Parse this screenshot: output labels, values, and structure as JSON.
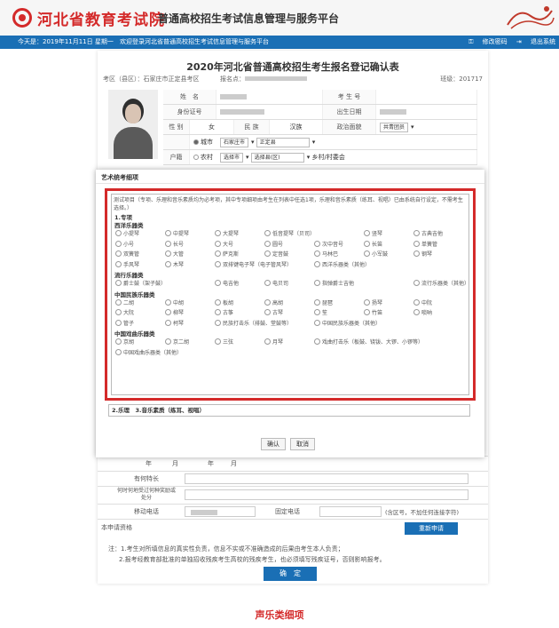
{
  "header": {
    "brand": "河北省教育考试院",
    "subtitle": "普通高校招生考试信息管理与服务平台"
  },
  "topbar": {
    "today": "今天是：2019年11月11日 星期一",
    "welcome": "欢迎登录河北省普通高校招生考试信息管理与服务平台",
    "change_password": "修改密码",
    "logout": "退出系统"
  },
  "form": {
    "title": "2020年河北省普通高校招生考生报名登记确认表",
    "exam_area": "考区（县区）：石家庄市正定县考区",
    "reg_no_label": "报名点：",
    "class_label": "班级：201717",
    "name_label": "姓　名",
    "exam_no_label": "考 生 号",
    "id_label": "身份证号",
    "birth_label": "出生日期",
    "gender_label": "性 别",
    "gender_value": "女",
    "ethnic_label": "民 族",
    "ethnic_value": "汉族",
    "political_label": "政治面貌",
    "political_value": "共青团员",
    "hukou_label": "户籍",
    "urban_label": "城市",
    "city_select": "石家庄市",
    "county_select": "正定县",
    "rural_label": "农村",
    "rural_city": "选择市",
    "rural_county": "选择县(区)",
    "village_label": "乡村/村委会",
    "year_label": "年",
    "month_label": "月",
    "year_label2": "年",
    "month_label2": "月",
    "specialty_label": "有何特长",
    "award_label": "何时何地受过何种奖励或处分",
    "mobile_label": "移动电话",
    "phone_label": "固定电话",
    "phone_hint": "(含区号，不加任何连接字符)",
    "resume_label": "本申请资格",
    "renew_button": "重新申请",
    "note1": "注：1.考生对所填信息的真实性负责，信息不实或不准确造成的后果由考生本人负责；",
    "note2": "2.报考经教育部批准的单独招收残疾考生高校的残疾考生，也必须填写残疾证号，否则影响报考。",
    "confirm_button": "确　定"
  },
  "modal": {
    "title": "艺术统考细项",
    "instruction": "测试项目（专项、乐理和音乐素质均为必考项，其中专项细项由考生在列表中任选1项，乐理和音乐素质（练耳、视唱）已由系统自行设定，不需考生选择。）",
    "section_main": "1.专项",
    "cat_western": "西洋乐器类",
    "western": [
      "小提琴",
      "中提琴",
      "大提琴",
      "低音提琴（贝司）",
      "竖琴",
      "古典吉他",
      "小号",
      "长号",
      "大号",
      "圆号",
      "次中音号",
      "长笛",
      "单簧管",
      "双簧管",
      "大管",
      "萨克斯",
      "定音鼓",
      "马林巴",
      "小军鼓",
      "钢琴",
      "手风琴",
      "木琴",
      "双排键电子琴（电子管风琴）",
      "西洋乐器类（其他）"
    ],
    "cat_popular": "流行乐器类",
    "popular": [
      "爵士鼓（架子鼓）",
      "电吉他",
      "电贝司",
      "指弹爵士吉他",
      "流行乐器类（其他）"
    ],
    "cat_chinese": "中国民族乐器类",
    "chinese": [
      "二胡",
      "中胡",
      "板胡",
      "高胡",
      "琵琶",
      "扬琴",
      "中阮",
      "大阮",
      "柳琴",
      "古筝",
      "古琴",
      "笙",
      "竹笛",
      "唢呐",
      "管子",
      "柯琴",
      "民族打击乐（排鼓、堂鼓等）",
      "中国民族乐器类（其他）"
    ],
    "cat_opera": "中国戏曲乐器类",
    "opera": [
      "京胡",
      "京二胡",
      "三弦",
      "月琴",
      "戏曲打击乐（板鼓、铙钹、大锣、小锣等）",
      "中国戏曲乐器类（其他）"
    ],
    "bottom_text": "2.乐理　3.音乐素质（练耳、视唱）",
    "ok_button": "确认",
    "cancel_button": "取消"
  },
  "caption": "声乐类细项"
}
